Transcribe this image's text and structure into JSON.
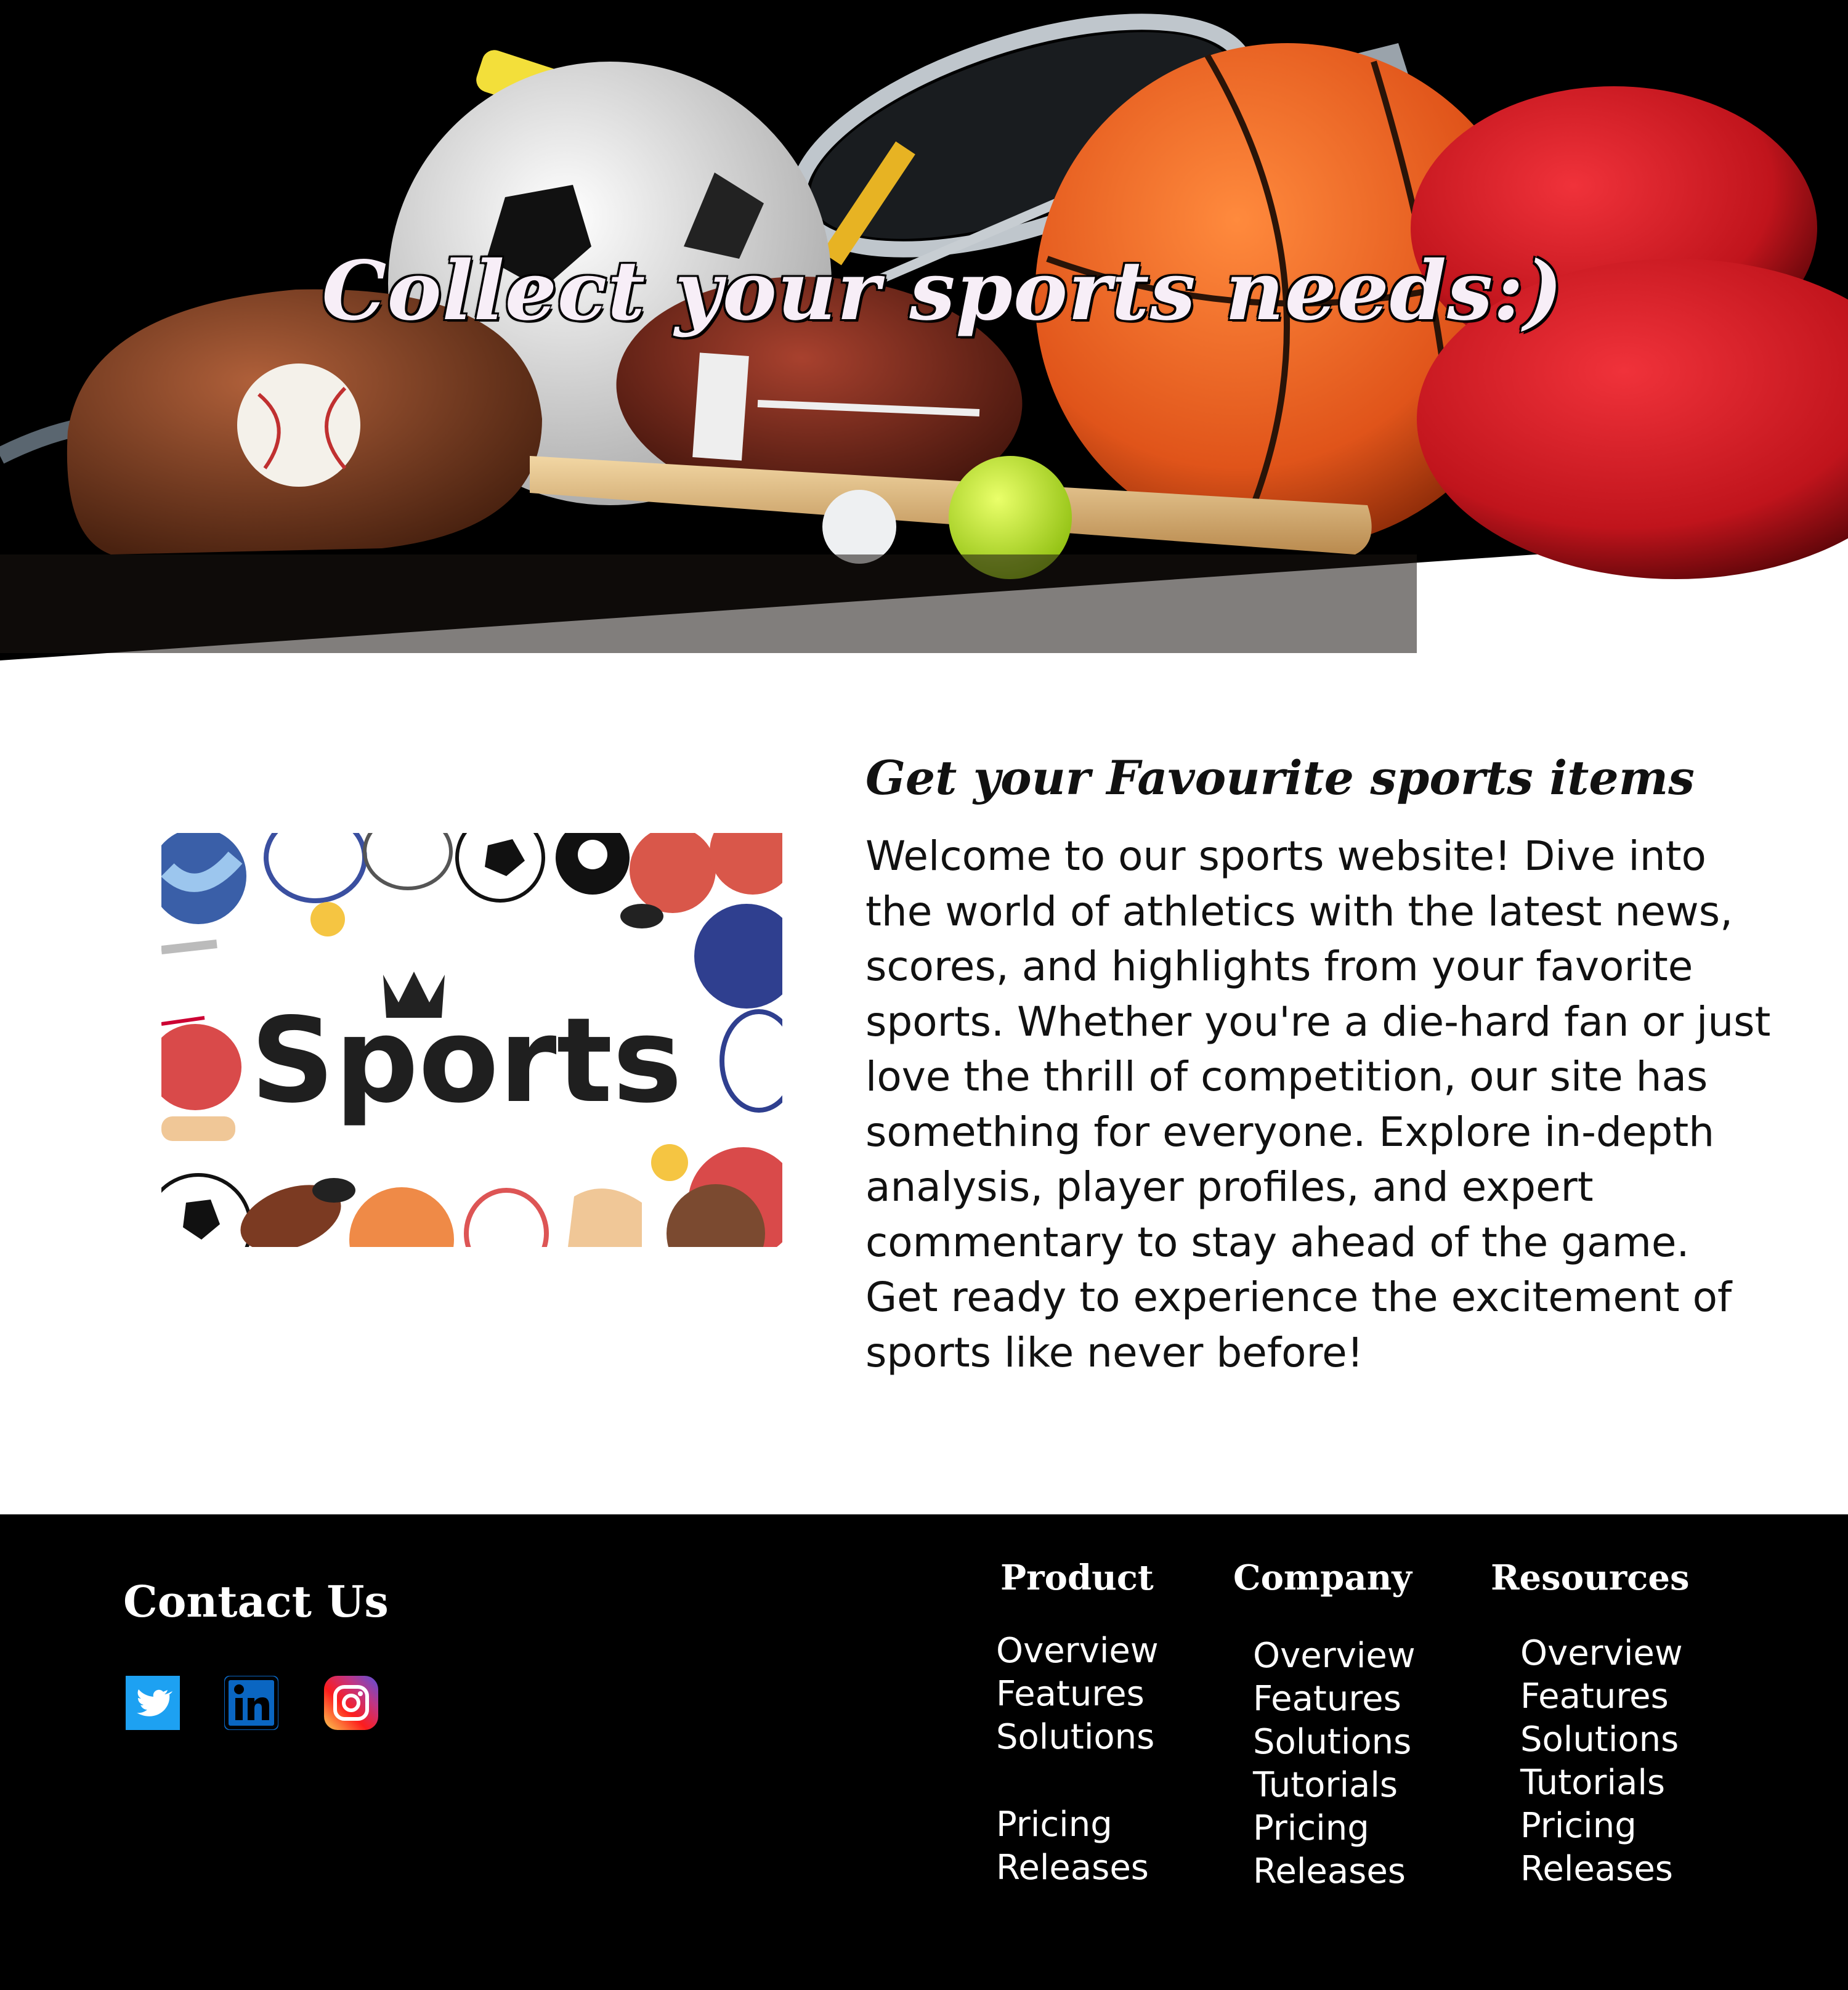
{
  "hero": {
    "title": "Collect your sports needs:)"
  },
  "main": {
    "image_alt": "Sports",
    "heading": "Get your Favourite sports items",
    "body": "Welcome to our sports website! Dive into the world of athletics with the latest news, scores, and highlights from your favorite sports. Whether you're a die-hard fan or just love the thrill of competition, our site has something for everyone. Explore in-depth analysis, player profiles, and expert commentary to stay ahead of the game. Get ready to experience the excitement of sports like never before!"
  },
  "footer": {
    "contact_heading": "Contact Us",
    "social": [
      "twitter-icon",
      "linkedin-icon",
      "instagram-icon"
    ],
    "columns": [
      {
        "title": "Product",
        "links": [
          "Overview",
          "Features",
          "Solutions",
          "Pricing",
          "Releases"
        ]
      },
      {
        "title": "Company",
        "links": [
          "Overview",
          "Features",
          "Solutions",
          "Tutorials",
          "Pricing",
          "Releases"
        ]
      },
      {
        "title": "Resources",
        "links": [
          "Overview",
          "Features",
          "Solutions",
          "Tutorials",
          "Pricing",
          "Releases"
        ]
      }
    ]
  },
  "colors": {
    "footer_bg": "#000000",
    "hero_bg": "#000000",
    "twitter": "#1DA1F2",
    "linkedin": "#0A66C2"
  }
}
